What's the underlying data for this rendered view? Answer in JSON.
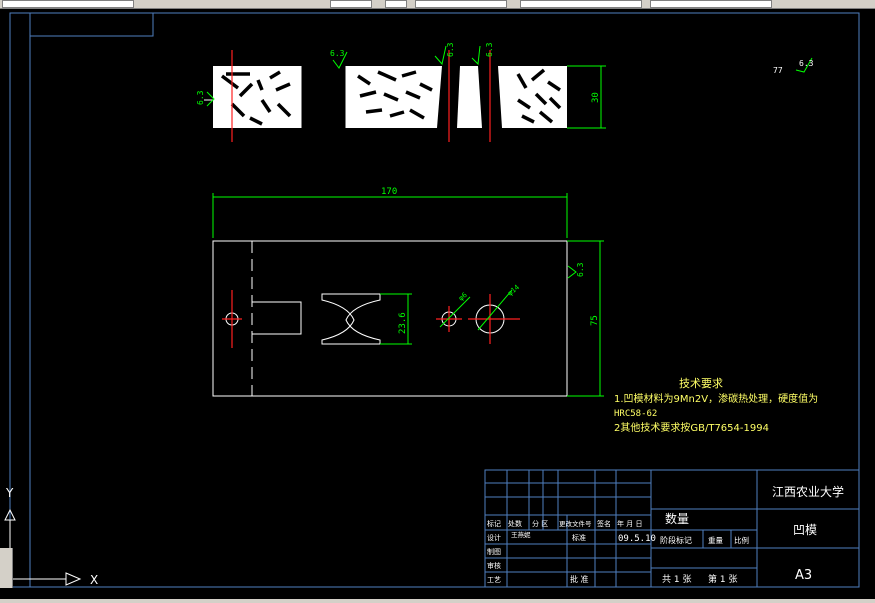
{
  "drawing": {
    "tech_title": "技术要求",
    "tech_line1": "1.凹模材料为9Mn2V，渗碳热处理，硬度值为",
    "tech_line2": "HRC58-62",
    "tech_line3": "2其他技术要求按GB/T7654-1994",
    "dim_170": "170",
    "dim_75": "75",
    "dim_30": "30",
    "dim_236": "23.6",
    "dim_phi6": "φ6",
    "dim_phi14": "φ14",
    "rough_63": "6.3",
    "rough_corner_prefix": "77"
  },
  "title_block": {
    "university": "江西农业大学",
    "part_name": "凹模",
    "quantity_label": "数量",
    "sheet_size": "A3",
    "h_mark": "标记",
    "h_count": "处数",
    "h_zone": "分 区",
    "h_docno": "更改文件号",
    "h_sign": "签名",
    "h_date": "年 月 日",
    "design": "设计",
    "designer": "王燕妮",
    "standard": "标准",
    "date": "09.5.10",
    "drafting": "制图",
    "review": "审核",
    "process": "工艺",
    "approve": "批 准",
    "stage": "阶段标记",
    "weight": "重量",
    "scale": "比例",
    "total_sheets": "共 1 张",
    "sheet_no": "第 1 张"
  },
  "ucs": {
    "y_label": "Y",
    "x_label": "X"
  },
  "colors": {
    "background": "#000000",
    "white": "#ffffff",
    "green": "#00ff00",
    "red": "#ff2020",
    "yellow": "#ffff66",
    "blue": "#4f7fbf"
  }
}
